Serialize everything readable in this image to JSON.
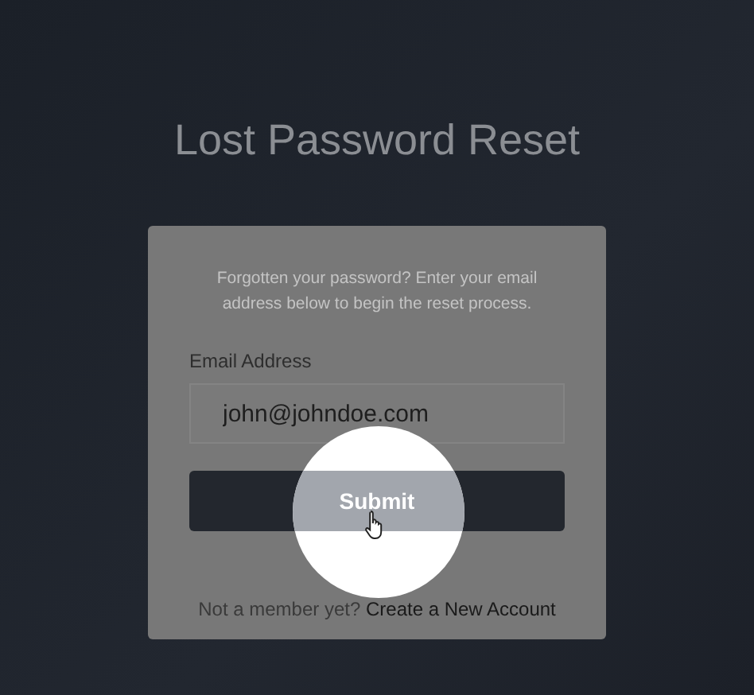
{
  "title": "Lost Password Reset",
  "form": {
    "intro": "Forgotten your password? Enter your email address below to begin the reset process.",
    "email_label": "Email Address",
    "email_value": "john@johndoe.com",
    "submit": "Submit",
    "footer_text": "Not a member yet?",
    "footer_link": "Create a New Account"
  }
}
